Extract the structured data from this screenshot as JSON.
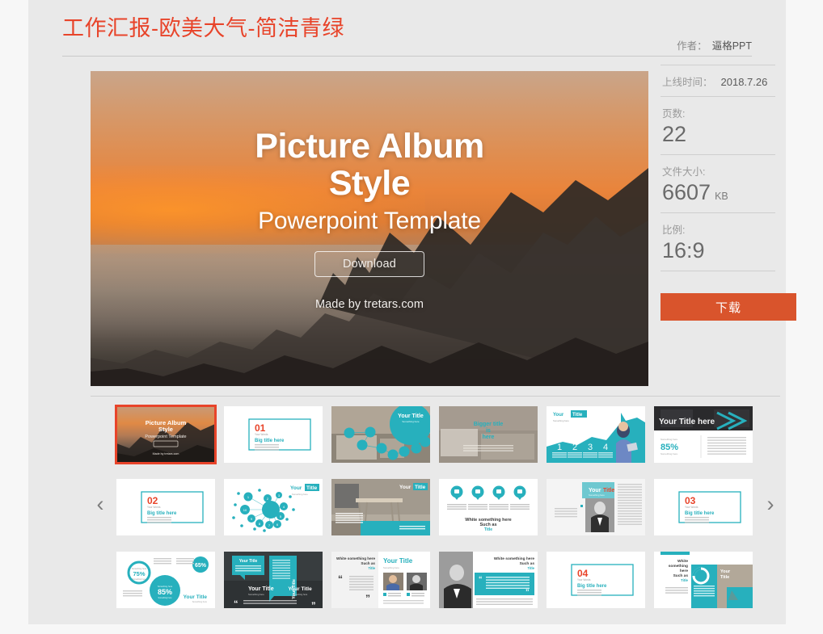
{
  "page": {
    "title": "工作汇报-欧美大气-简洁青绿",
    "author_label": "作者：",
    "author_name": "逼格PPT"
  },
  "meta": {
    "publish_label": "上线时间：",
    "publish_value": "2018.7.26",
    "pages_label": "页数:",
    "pages_value": "22",
    "filesize_label": "文件大小:",
    "filesize_value": "6607",
    "filesize_unit": "KB",
    "ratio_label": "比例:",
    "ratio_value": "16:9",
    "download_button": "下载"
  },
  "hero": {
    "title_line1": "Picture Album",
    "title_line2": "Style",
    "subtitle": "Powerpoint Template",
    "button": "Download",
    "made_by": "Made by tretars.com"
  },
  "carousel": {
    "prev_icon": "‹",
    "next_icon": "›",
    "thumbnails": [
      {
        "id": 1,
        "name": "slide-cover-picture-album",
        "kind": "cover",
        "selected": true,
        "caption": "Picture Album Style"
      },
      {
        "id": 2,
        "name": "slide-section-01",
        "kind": "section",
        "selected": false,
        "number": "01",
        "caption": "Big title here"
      },
      {
        "id": 3,
        "name": "slide-network-photo",
        "kind": "photo-bubble",
        "selected": false,
        "caption": "Your Title"
      },
      {
        "id": 4,
        "name": "slide-bigger-title-here",
        "kind": "photo-text",
        "selected": false,
        "caption": "Bigger title is here"
      },
      {
        "id": 5,
        "name": "slide-steps-1234",
        "kind": "steps",
        "selected": false,
        "caption": "Your Title",
        "steps": [
          "1",
          "2",
          "3",
          "4"
        ]
      },
      {
        "id": 6,
        "name": "slide-percent-85",
        "kind": "percent-dark",
        "selected": false,
        "caption": "Your Title",
        "percent": "85%"
      },
      {
        "id": 7,
        "name": "slide-section-02",
        "kind": "section",
        "selected": false,
        "number": "02",
        "caption": "Big title here"
      },
      {
        "id": 8,
        "name": "slide-mindmap",
        "kind": "mindmap",
        "selected": false,
        "caption": "Your Title"
      },
      {
        "id": 9,
        "name": "slide-interior-photo",
        "kind": "photo-right",
        "selected": false,
        "caption": "Your Title"
      },
      {
        "id": 10,
        "name": "slide-four-icons",
        "kind": "icons4",
        "selected": false,
        "caption": "White something here Such as",
        "caption2": "Title"
      },
      {
        "id": 11,
        "name": "slide-magazine-portrait",
        "kind": "magazine",
        "selected": false,
        "caption": "Your Title"
      },
      {
        "id": 12,
        "name": "slide-section-03",
        "kind": "section",
        "selected": false,
        "number": "03",
        "caption": "Big title here"
      },
      {
        "id": 13,
        "name": "slide-percent-circles",
        "kind": "circles",
        "selected": false,
        "caption": "Your Title",
        "percents": [
          "75%",
          "65%",
          "85%"
        ]
      },
      {
        "id": 14,
        "name": "slide-dark-quote-panels",
        "kind": "dark-quote",
        "selected": false,
        "caption": "Your Title"
      },
      {
        "id": 15,
        "name": "slide-two-portraits-quote",
        "kind": "quote-two",
        "selected": false,
        "caption": "Your Title"
      },
      {
        "id": 16,
        "name": "slide-portrait-teal-quote",
        "kind": "quote-teal",
        "selected": false,
        "caption": "White something here Such as"
      },
      {
        "id": 17,
        "name": "slide-section-04",
        "kind": "section",
        "selected": false,
        "number": "04",
        "caption": "Big title here"
      },
      {
        "id": 18,
        "name": "slide-donut-interior",
        "kind": "donut",
        "selected": false,
        "caption": "Your Title"
      }
    ]
  },
  "colors": {
    "accent_orange": "#e8442a",
    "download_orange": "#d9542c",
    "teal": "#27b0bd",
    "panel_bg": "#e9e9e9",
    "page_bg": "#f7f7f7"
  }
}
